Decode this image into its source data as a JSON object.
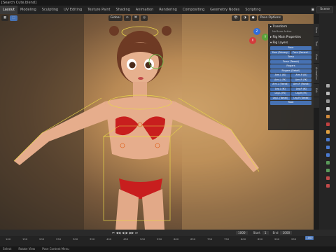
{
  "window": {
    "title": "[Search Cute.blend]"
  },
  "workspaces": [
    "Layout",
    "Modeling",
    "Sculpting",
    "UV Editing",
    "Texture Paint",
    "Shading",
    "Animation",
    "Rendering",
    "Compositing",
    "Geometry Nodes",
    "Scripting"
  ],
  "active_workspace_index": 0,
  "scene_label": "Scene",
  "viewport": {
    "header": {
      "mode_label": "Global",
      "pose_options_label": "Pose Options"
    }
  },
  "n_panel": {
    "transform_label": "Transform",
    "no_bone_active": "No Bone Active",
    "rig_main_props": "Rig Main Properties",
    "rig_layers_label": "Rig Layers",
    "layers": [
      {
        "type": "full",
        "label": "Face"
      },
      {
        "type": "row",
        "left": "Face (Primary)",
        "right": "Face (Second..."
      },
      {
        "type": "full",
        "label": "Torso"
      },
      {
        "type": "full",
        "label": "Torso (Tweak)"
      },
      {
        "type": "full",
        "label": "Fingers"
      },
      {
        "type": "full",
        "label": "Fingers (Detail)"
      },
      {
        "type": "row",
        "left": "Arm.L (IK)",
        "right": "Arm.R (IK)"
      },
      {
        "type": "row",
        "left": "Arm.L (FK)",
        "right": "Arm.R (FK)"
      },
      {
        "type": "row",
        "left": "Arm.L (Tweak)",
        "right": "Arm.R (Tweak)"
      },
      {
        "type": "row",
        "left": "Leg.L (IK)",
        "right": "Leg.R (IK)"
      },
      {
        "type": "row",
        "left": "Leg.L (FK)",
        "right": "Leg.R (FK)"
      },
      {
        "type": "row",
        "left": "Leg.L (Tweak)",
        "right": "Leg.R (Tweak)"
      },
      {
        "type": "full",
        "label": "Root"
      }
    ]
  },
  "side_tabs": [
    "Item",
    "Tool",
    "View",
    "Animation",
    "Edit"
  ],
  "timeline": {
    "start_label": "Start",
    "start": "1",
    "end_label": "End",
    "end": "1000",
    "current_frame": "1000",
    "ruler": [
      "100",
      "150",
      "200",
      "250",
      "300",
      "350",
      "400",
      "450",
      "500",
      "550",
      "600",
      "650",
      "700",
      "750",
      "800",
      "850",
      "900",
      "950"
    ]
  },
  "statusbar": {
    "select": "Select",
    "rotate": "Rotate View",
    "menu": "Pose Context Menu"
  }
}
